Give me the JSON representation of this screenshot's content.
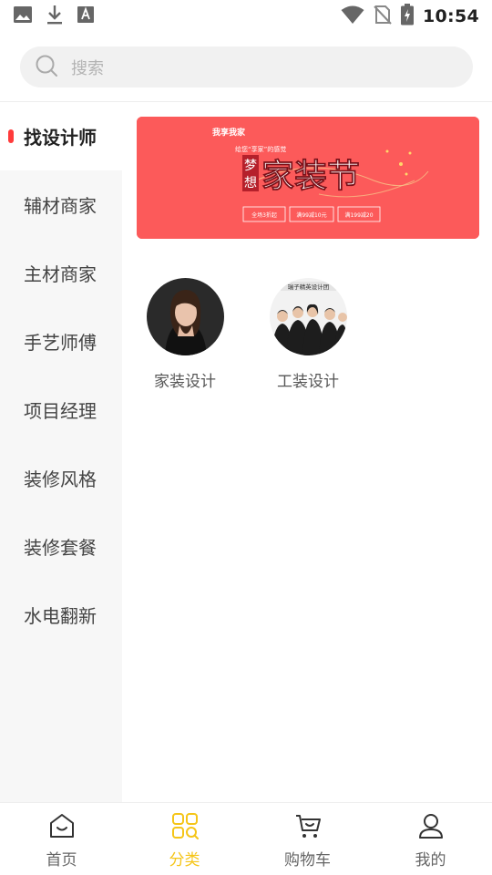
{
  "status_bar": {
    "time": "10:54",
    "left_icons": [
      "image-icon",
      "download-icon",
      "font-icon"
    ],
    "right_icons": [
      "wifi-icon",
      "no-sim-icon",
      "battery-charging-icon"
    ]
  },
  "search": {
    "placeholder": "搜索",
    "icon": "search-icon"
  },
  "sidebar": {
    "items": [
      {
        "label": "找设计师",
        "active": true
      },
      {
        "label": "辅材商家",
        "active": false
      },
      {
        "label": "主材商家",
        "active": false
      },
      {
        "label": "手艺师傅",
        "active": false
      },
      {
        "label": "项目经理",
        "active": false
      },
      {
        "label": "装修风格",
        "active": false
      },
      {
        "label": "装修套餐",
        "active": false
      },
      {
        "label": "水电翻新",
        "active": false
      }
    ],
    "active_indicator_color": "#ff3b3b"
  },
  "banner": {
    "brand": "我享我家",
    "subtitle": "给您“享家”的感觉",
    "vertical_text": "梦想",
    "title": "家装节",
    "tags": [
      "全场3折起",
      "满99减10元",
      "满199减20"
    ],
    "background_color": "#fc5a5a"
  },
  "categories": [
    {
      "label": "家装设计"
    },
    {
      "label": "工装设计",
      "image_caption": "瑞子精英设计团"
    }
  ],
  "bottom_nav": {
    "items": [
      {
        "label": "首页",
        "icon": "home-icon",
        "active": false
      },
      {
        "label": "分类",
        "icon": "category-icon",
        "active": true
      },
      {
        "label": "购物车",
        "icon": "cart-icon",
        "active": false
      },
      {
        "label": "我的",
        "icon": "profile-icon",
        "active": false
      }
    ],
    "active_color": "#f5c518"
  }
}
